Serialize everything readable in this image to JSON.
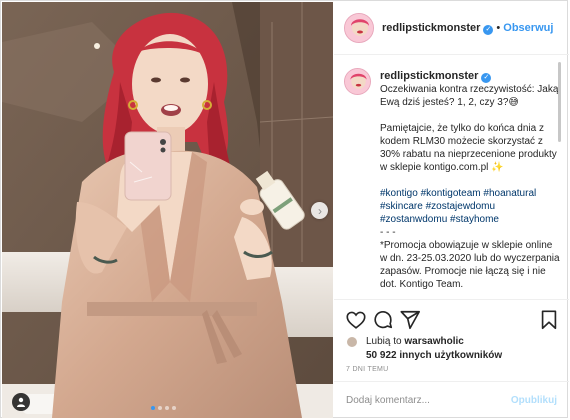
{
  "post": {
    "image_alt": "",
    "carousel": {
      "count": 4,
      "active_index": 0
    }
  },
  "header": {
    "username": "redlipstickmonster",
    "separator": "•",
    "follow_label": "Obserwuj"
  },
  "caption": {
    "author": "redlipstickmonster",
    "paragraphs": [
      "Oczekiwania kontra rzeczywistość: Jaką Ewą dziś jesteś? 1, 2, czy 3?😅",
      "Pamiętajcie, że tylko do końca dnia z kodem RLM30 możecie skorzystać z 30% rabatu na nieprzecenione produkty w sklepie kontigo.com.pl ✨",
      "#kontigo #kontigoteam #hoanatural #skincare #zostajewdomu #zostanwdomu #stayhome",
      "- - -",
      "*Promocja obowiązuje w sklepie online w dn. 23-25.03.2020 lub do wyczerpania zapasów. Promocje nie łączą się i nie dot. Kontigo Team."
    ]
  },
  "likes": {
    "line1_prefix": "Lubią to",
    "line1_user": "warsawholic",
    "line2": "50 922 innych użytkowników"
  },
  "timestamp": "7 DNI TEMU",
  "comment": {
    "placeholder": "Dodaj komentarz...",
    "value": "",
    "publish_label": "Opublikuj"
  },
  "icons": {
    "like": "heart-icon",
    "comment": "comment-icon",
    "share": "share-icon",
    "save": "bookmark-icon",
    "next": "chevron-right-icon",
    "user_tag": "user-tag-icon"
  },
  "colors": {
    "accent": "#3897f0",
    "publish_disabled": "#b2dffc",
    "hashtag": "#00376b",
    "robe": "#d9b39c",
    "hair": "#c8323f"
  }
}
